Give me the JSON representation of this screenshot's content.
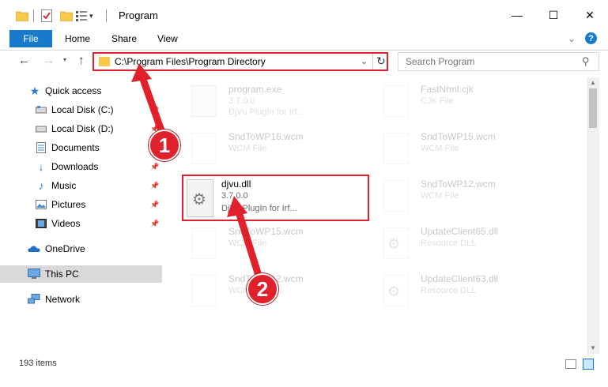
{
  "window": {
    "title": "Program",
    "controls": {
      "minimize": "—",
      "maximize": "☐",
      "close": "✕"
    }
  },
  "ribbon": {
    "tabs": [
      "File",
      "Home",
      "Share",
      "View"
    ]
  },
  "address_bar": {
    "path": "C:\\Program Files\\Program Directory",
    "search_placeholder": "Search Program"
  },
  "nav_pane": {
    "items": [
      {
        "label": "Quick access",
        "icon": "star-icon",
        "pinned": false
      },
      {
        "label": "Local Disk (C:)",
        "icon": "drive-icon",
        "pinned": true
      },
      {
        "label": "Local Disk (D:)",
        "icon": "drive-icon",
        "pinned": true
      },
      {
        "label": "Documents",
        "icon": "documents-icon",
        "pinned": true
      },
      {
        "label": "Downloads",
        "icon": "download-icon",
        "pinned": true
      },
      {
        "label": "Music",
        "icon": "music-icon",
        "pinned": true
      },
      {
        "label": "Pictures",
        "icon": "pictures-icon",
        "pinned": true
      },
      {
        "label": "Videos",
        "icon": "videos-icon",
        "pinned": true
      },
      {
        "label": "OneDrive",
        "icon": "cloud-icon",
        "pinned": false
      },
      {
        "label": "This PC",
        "icon": "computer-icon",
        "pinned": false,
        "selected": true
      },
      {
        "label": "Network",
        "icon": "network-icon",
        "pinned": false
      }
    ]
  },
  "files": [
    {
      "name": "program.exe",
      "line2": "3.7.0.0",
      "line3": "DjVu PlugIn for Irf...",
      "type": "exe"
    },
    {
      "name": "FastNrml.cjk",
      "line2": "CJK File",
      "line3": "",
      "type": "doc"
    },
    {
      "name": "SndToWP16.wcm",
      "line2": "WCM File",
      "line3": "",
      "type": "doc"
    },
    {
      "name": "SndToWP15.wcm",
      "line2": "WCM File",
      "line3": "",
      "type": "doc"
    },
    {
      "name": "SndToWP12.wcm",
      "line2": "WCM File",
      "line3": "",
      "type": "doc"
    },
    {
      "name": "SndToWP15.wcm",
      "line2": "WCM File",
      "line3": "",
      "type": "doc"
    },
    {
      "name": "UpdateClient65.dll",
      "line2": "Resource DLL",
      "line3": "",
      "type": "dll"
    },
    {
      "name": "SndToWP12.wcm",
      "line2": "WCM File",
      "line3": "",
      "type": "doc"
    },
    {
      "name": "UpdateClient63.dll",
      "line2": "Resource DLL",
      "line3": "",
      "type": "dll"
    }
  ],
  "highlighted_file": {
    "name": "djvu.dll",
    "line2": "3.7.0.0",
    "line3": "DjVu PlugIn for Irf..."
  },
  "status_bar": {
    "item_count": "193 items"
  },
  "annotations": {
    "step1": "1",
    "step2": "2"
  },
  "colors": {
    "accent": "#1979ca",
    "annotation_red": "#e0202a",
    "selection": "#cce8ff"
  }
}
